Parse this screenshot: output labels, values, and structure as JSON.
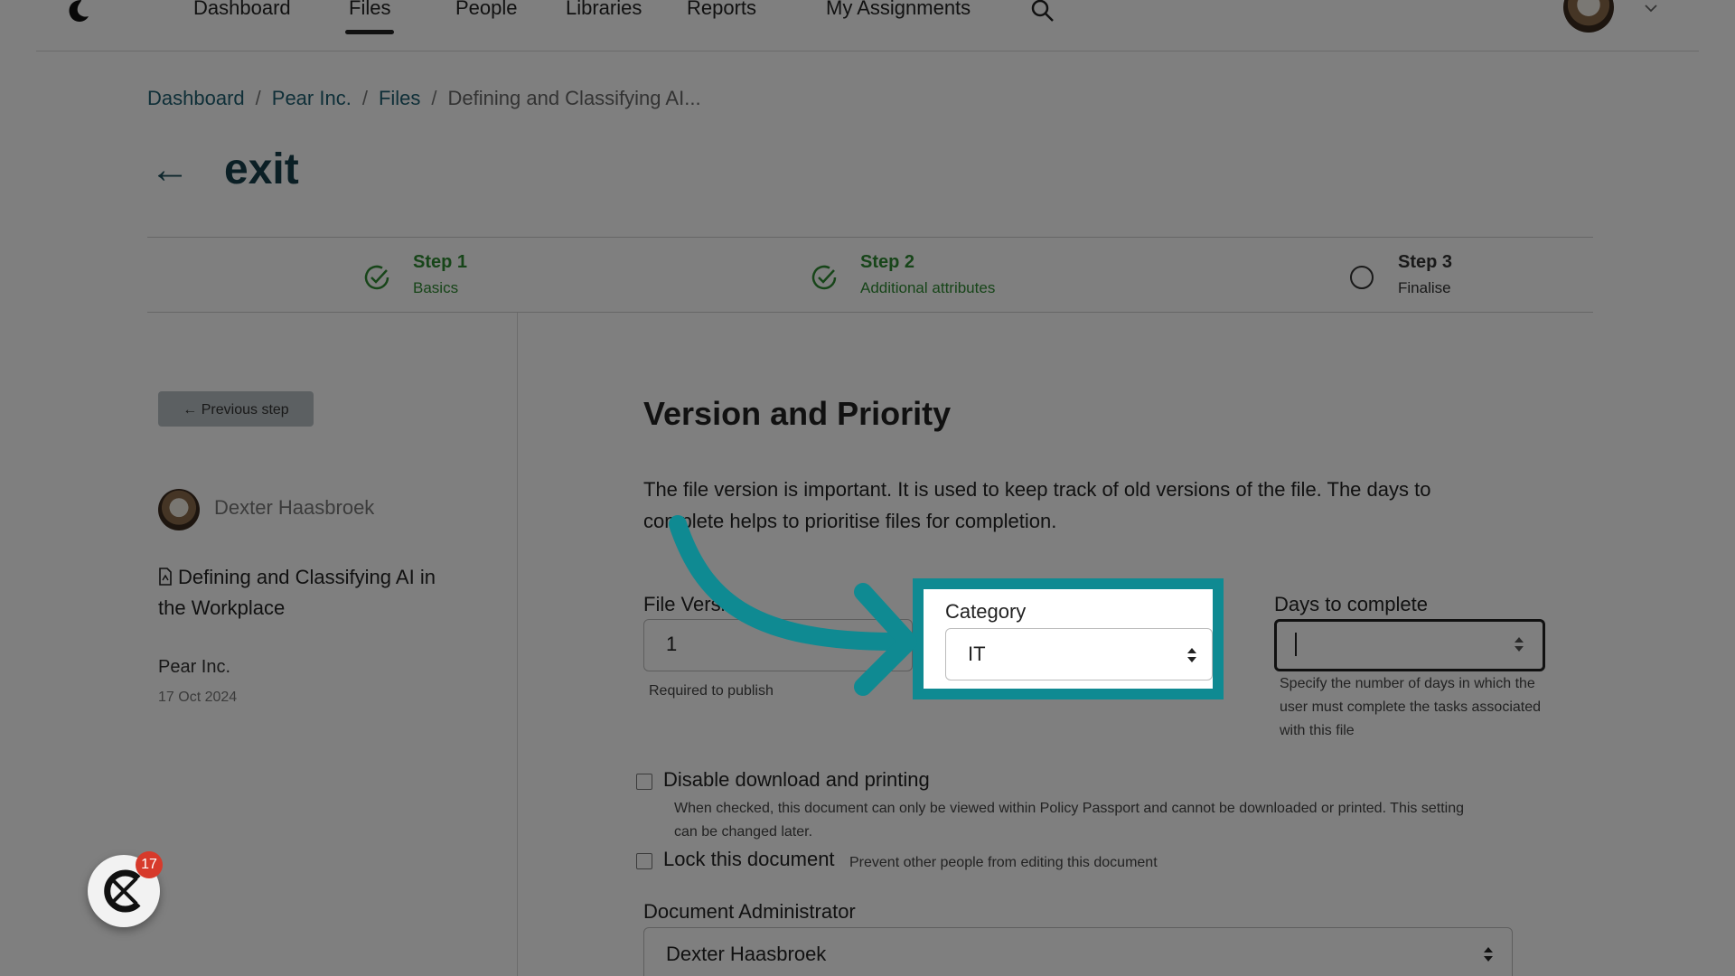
{
  "nav": {
    "items": [
      "Dashboard",
      "Files",
      "People",
      "Libraries",
      "Reports",
      "My Assignments"
    ],
    "active": "Files"
  },
  "breadcrumb": {
    "items": [
      "Dashboard",
      "Pear Inc.",
      "Files"
    ],
    "current": "Defining and Classifying AI...",
    "separator": "/"
  },
  "page": {
    "back": "←",
    "title": "exit"
  },
  "steps": [
    {
      "title": "Step 1",
      "subtitle": "Basics",
      "state": "done"
    },
    {
      "title": "Step 2",
      "subtitle": "Additional attributes",
      "state": "done"
    },
    {
      "title": "Step 3",
      "subtitle": "Finalise",
      "state": "pending"
    }
  ],
  "sidebar": {
    "prev_button": "← Previous step",
    "user": "Dexter Haasbroek",
    "document": "Defining and Classifying AI in the Workplace",
    "org": "Pear Inc.",
    "date": "17 Oct 2024"
  },
  "section": {
    "title": "Version and Priority",
    "description": "The file version is important. It is used to keep track of old versions of the file. The days to complete helps to prioritise files for completion."
  },
  "fields": {
    "file_version_label": "File Versi",
    "file_version_value": "1",
    "file_version_help": "Required to publish",
    "category_label": "Category",
    "category_value": "IT",
    "days_label": "Days to complete",
    "days_value": "",
    "days_help": "Specify the number of days in which the user must complete the tasks associated with this file"
  },
  "options": {
    "disable_label": "Disable download and printing",
    "disable_help": "When checked, this document can only be viewed within Policy Passport and cannot be downloaded or printed. This setting can be changed later.",
    "lock_label": "Lock this document",
    "lock_help": "Prevent other people from editing this document"
  },
  "admin": {
    "label": "Document Administrator",
    "value": "Dexter Haasbroek"
  },
  "widget": {
    "badge": "17"
  },
  "colors": {
    "accent": "#0f8a92",
    "step_done": "#2f8a32",
    "badge": "#d73a2b"
  }
}
